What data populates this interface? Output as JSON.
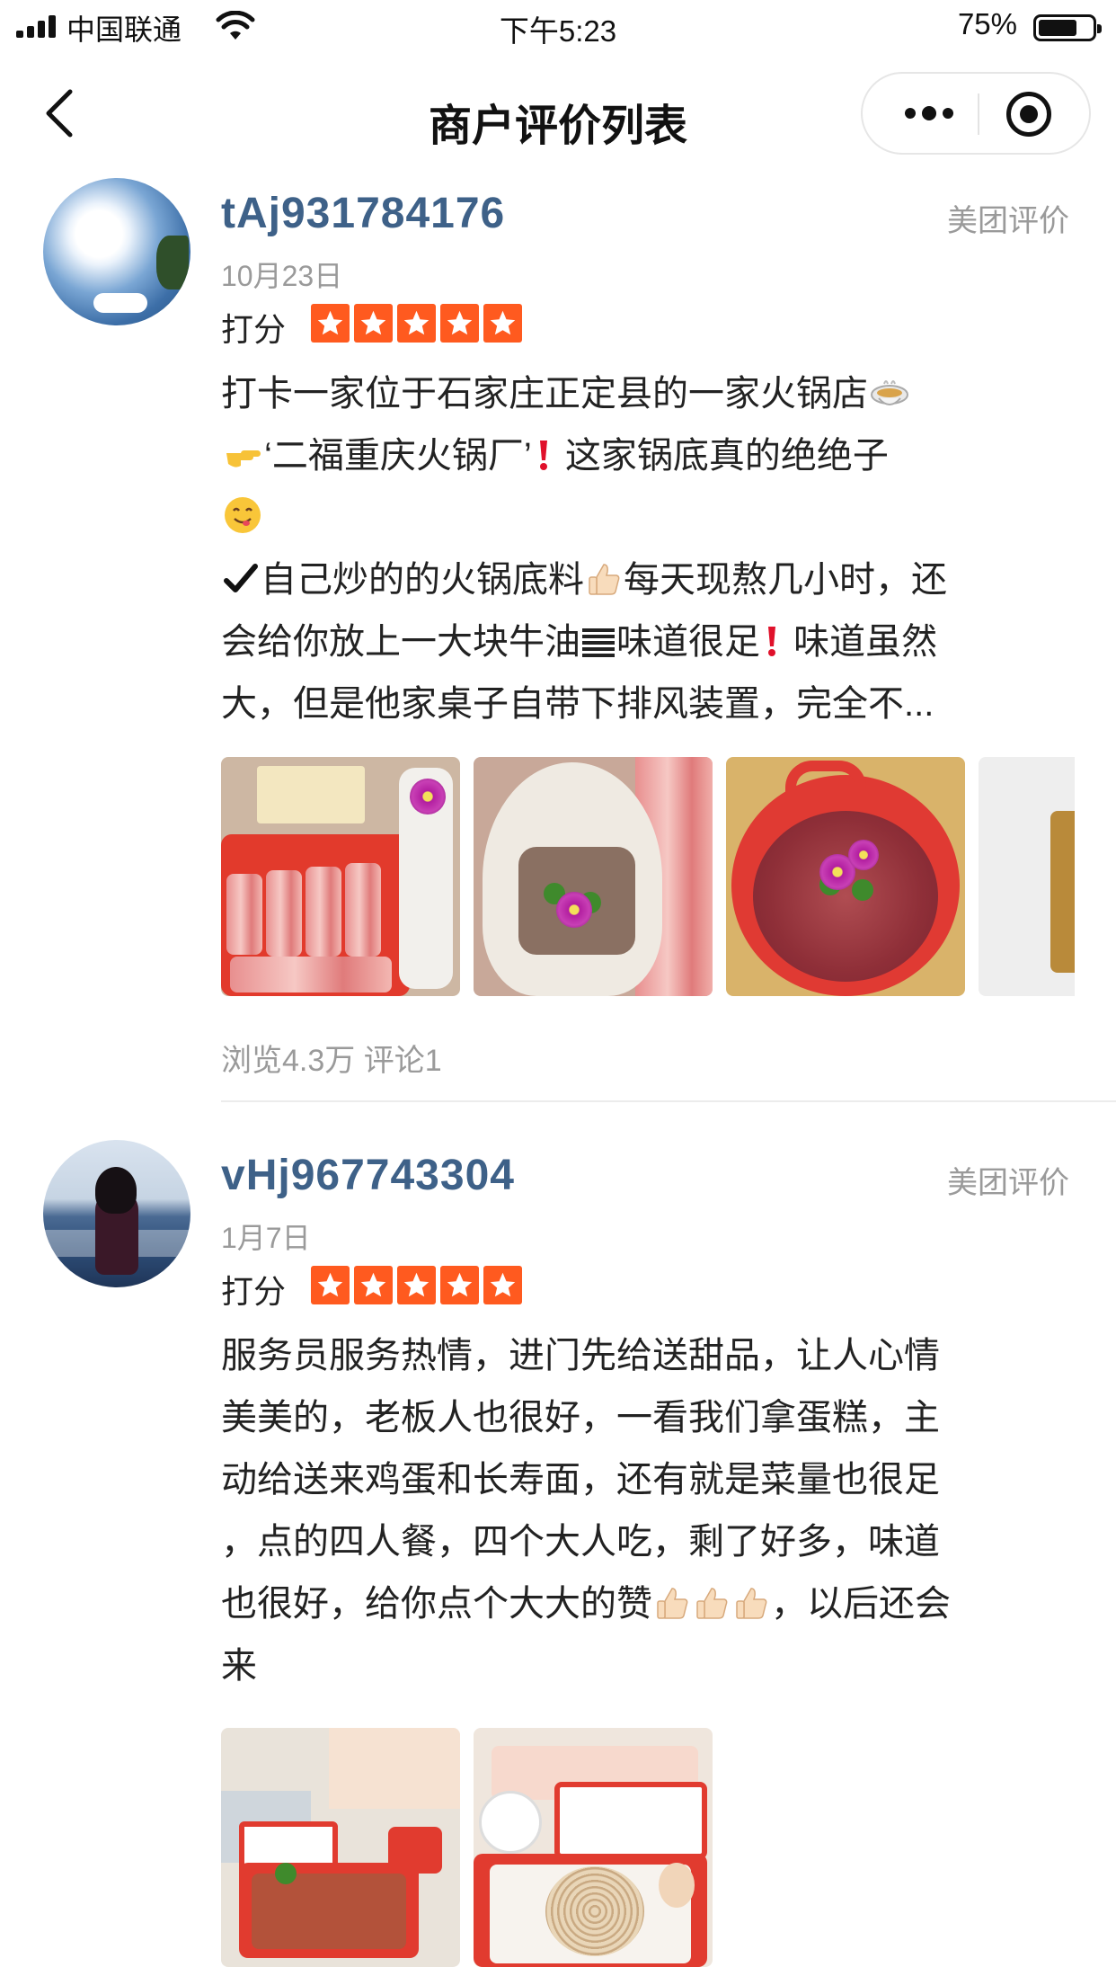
{
  "status_bar": {
    "carrier": "中国联通",
    "time": "下午5:23",
    "battery": "75%",
    "battery_level": 0.75
  },
  "nav": {
    "title": "商户评价列表",
    "back_icon": "chevron-left-icon",
    "more_icon": "more-dots-icon",
    "close_icon": "target-circle-icon"
  },
  "colors": {
    "username": "#3e6188",
    "star": "#ff5a1f",
    "muted": "#9a9a9a",
    "exclaim": "#e0112b"
  },
  "reviews": [
    {
      "username": "tAj931784176",
      "source": "美团评价",
      "date": "10月23日",
      "score_label": "打分",
      "rating": 5,
      "lines": [
        "打卡一家位于石家庄正定县的一家火锅店",
        "‘二福重庆火锅厂’",
        "这家锅底真的绝绝子",
        "自己炒的的火锅底料",
        "每天现熬几小时，还",
        "会给你放上一大块牛油",
        "味道很足",
        "味道虽然",
        "大，但是他家桌子自带下排风装置，完全不..."
      ],
      "photo_count_visible": 4,
      "stats": "浏览4.3万 评论1"
    },
    {
      "username": "vHj967743304",
      "source": "美团评价",
      "date": "1月7日",
      "score_label": "打分",
      "rating": 5,
      "lines": [
        "服务员服务热情，进门先给送甜品，让人心情",
        "美美的，老板人也很好，一看我们拿蛋糕，主",
        "动给送来鸡蛋和长寿面，还有就是菜量也很足",
        "，点的四人餐，四个大人吃，剩了好多，味道",
        "也很好，给你点个大大的赞",
        "，以后还会",
        "来"
      ],
      "photo_count_visible": 2
    }
  ]
}
